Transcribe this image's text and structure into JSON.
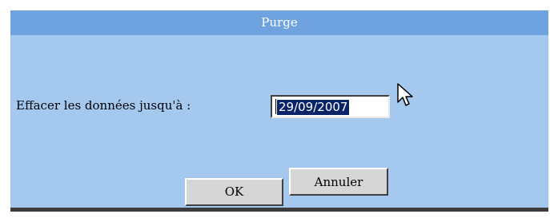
{
  "dialog": {
    "title": "Purge",
    "field_label": "Effacer les données jusqu'à :",
    "date_value": "29/09/2007",
    "ok_label": "OK",
    "cancel_label": "Annuler"
  },
  "icons": {
    "cursor": "mouse-pointer-arrow"
  },
  "colors": {
    "titlebar": "#6ea3e0",
    "dialog_background": "#a4c8ee",
    "selection_background": "#0a246a",
    "button_face": "#d6d6d6"
  }
}
